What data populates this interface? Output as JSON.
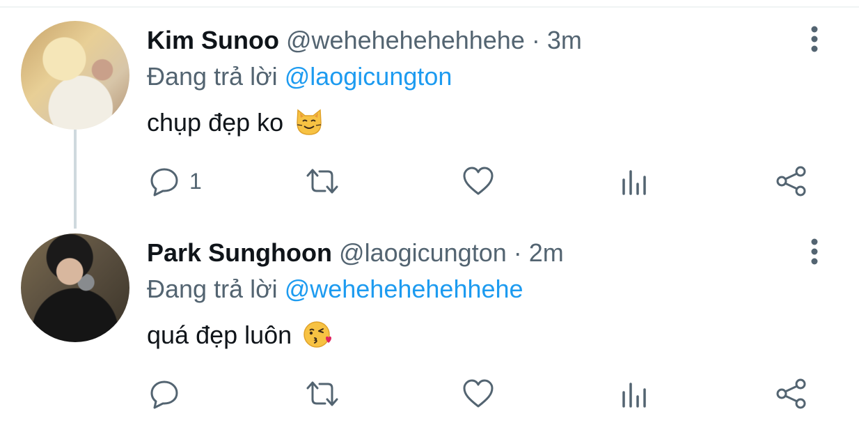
{
  "tweets": [
    {
      "display_name": "Kim Sunoo",
      "handle": "@wehehehehehhehe",
      "separator": "·",
      "time": "3m",
      "reply_prefix": "Đang trả lời",
      "reply_to": "@laogicungton",
      "text": "chụp đẹp ko",
      "emoji": "smiling-cat-emoji",
      "reply_count": "1"
    },
    {
      "display_name": "Park Sunghoon",
      "handle": "@laogicungton",
      "separator": "·",
      "time": "2m",
      "reply_prefix": "Đang trả lời",
      "reply_to": "@wehehehehehhehe",
      "text": "quá đẹp luôn",
      "emoji": "kissing-face-emoji",
      "reply_count": ""
    }
  ],
  "icons": {
    "reply": "reply-icon",
    "retweet": "retweet-icon",
    "like": "heart-icon",
    "stats": "stats-icon",
    "share": "share-icon",
    "more": "more-vertical-icon"
  },
  "colors": {
    "text": "#0f1419",
    "secondary": "#536471",
    "link": "#1d9bf0",
    "thread_line": "#cfd9de"
  }
}
